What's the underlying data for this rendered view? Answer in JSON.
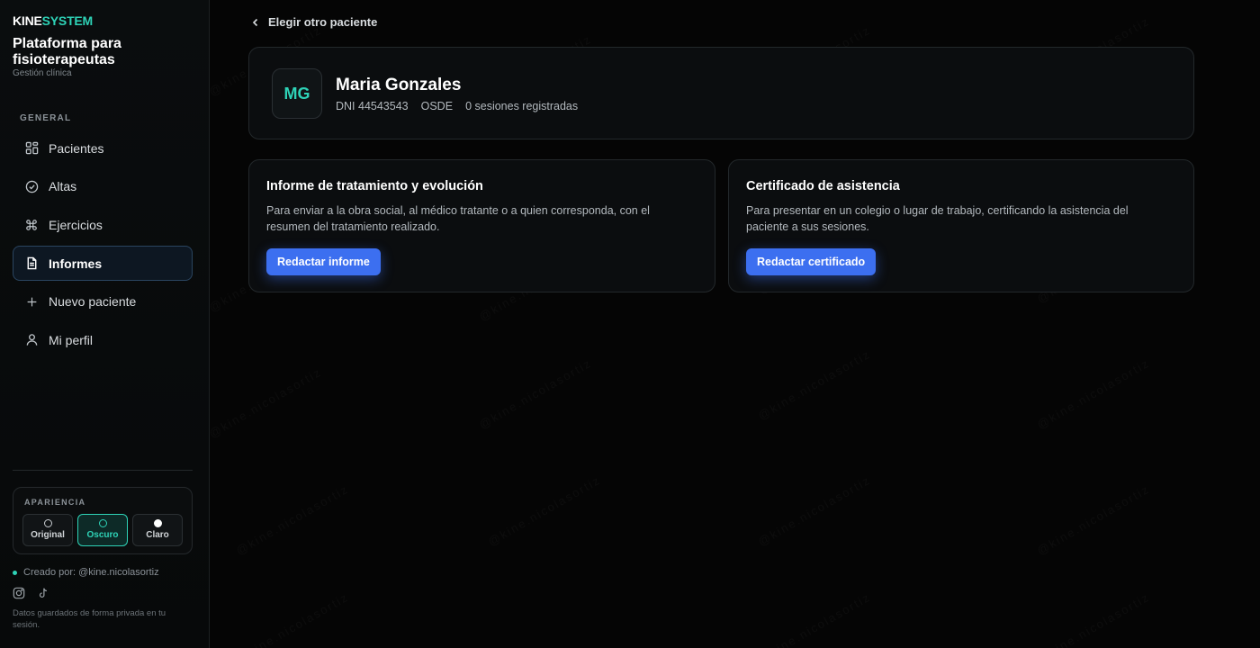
{
  "brand": {
    "kine": "KINE",
    "system": "SYSTEM"
  },
  "sidebar": {
    "title": "Plataforma para fisioterapeutas",
    "subtitle": "Gestión clínica",
    "section_label": "GENERAL",
    "items": [
      {
        "label": "Pacientes",
        "icon": "grid-icon",
        "active": false
      },
      {
        "label": "Altas",
        "icon": "check-circle-icon",
        "active": false
      },
      {
        "label": "Ejercicios",
        "icon": "command-icon",
        "active": false
      },
      {
        "label": "Informes",
        "icon": "document-icon",
        "active": true
      },
      {
        "label": "Nuevo paciente",
        "icon": "plus-icon",
        "active": false
      },
      {
        "label": "Mi perfil",
        "icon": "user-icon",
        "active": false
      }
    ],
    "appearance": {
      "label": "APARIENCIA",
      "options": [
        {
          "label": "Original",
          "active": false
        },
        {
          "label": "Oscuro",
          "active": true
        },
        {
          "label": "Claro",
          "active": false
        }
      ]
    },
    "credit": "Creado por: @kine.nicolasortiz",
    "socials": [
      "instagram-icon",
      "tiktok-icon"
    ],
    "privacy": "Datos guardados de forma privada en tu sesión."
  },
  "main": {
    "back_label": "Elegir otro paciente",
    "patient": {
      "initials": "MG",
      "name": "Maria Gonzales",
      "dni": "DNI 44543543",
      "insurance": "OSDE",
      "sessions": "0 sesiones registradas"
    },
    "cards": [
      {
        "title": "Informe de tratamiento y evolución",
        "description": "Para enviar a la obra social, al médico tratante o a quien corresponda, con el resumen del tratamiento realizado.",
        "button": "Redactar informe"
      },
      {
        "title": "Certificado de asistencia",
        "description": "Para presentar en un colegio o lugar de trabajo, certificando la asistencia del paciente a sus sesiones.",
        "button": "Redactar certificado"
      }
    ]
  },
  "watermark_text": "@kine.nicolasortiz",
  "colors": {
    "accent": "#2ed3b7",
    "primary": "#3c6ff0",
    "background": "#050505"
  }
}
